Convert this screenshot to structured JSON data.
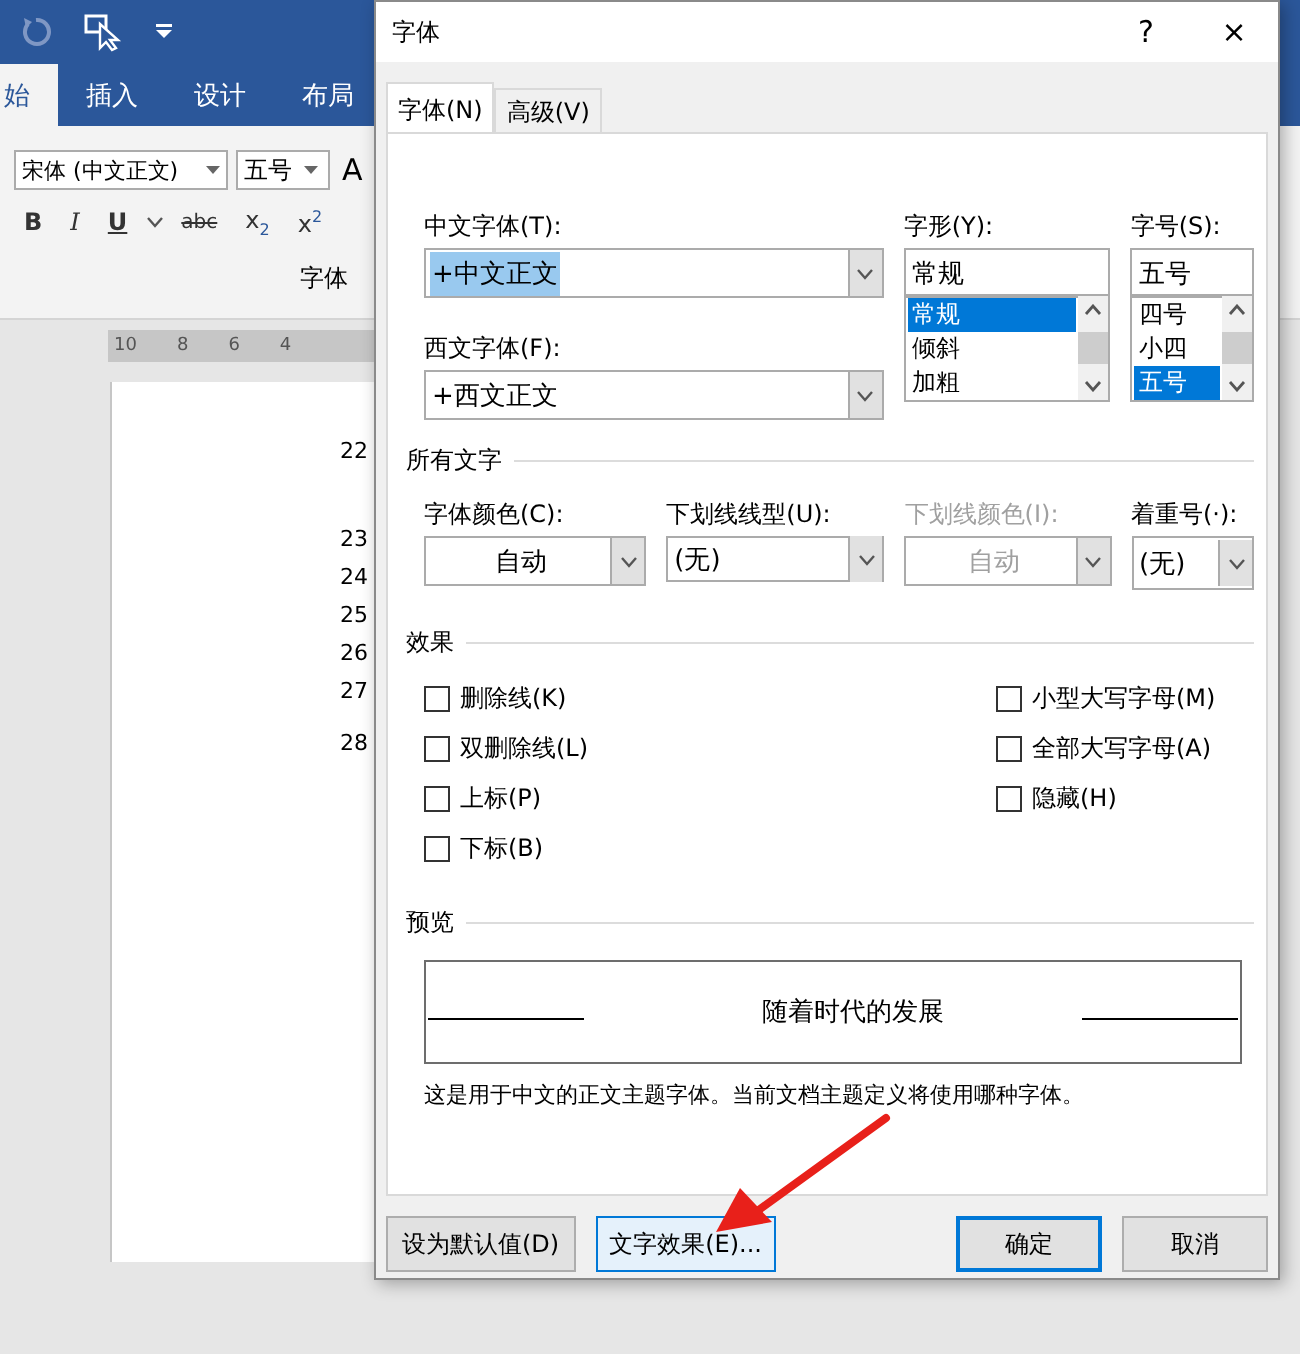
{
  "word": {
    "ribbon_tabs": [
      {
        "label": "始",
        "selected": true
      },
      {
        "label": "插入",
        "selected": false
      },
      {
        "label": "设计",
        "selected": false
      },
      {
        "label": "布局",
        "selected": false
      }
    ],
    "font_name": "宋体 (中文正文)",
    "font_size": "五号",
    "grow_font": "A",
    "format_buttons": [
      {
        "label": "B",
        "kind": "bold"
      },
      {
        "label": "I",
        "kind": "italic"
      },
      {
        "label": "U",
        "kind": "underline"
      },
      {
        "label": "abc",
        "kind": "strike"
      },
      {
        "label": "x$_{2}$",
        "kind": "plain"
      },
      {
        "label": "x$^{2}$",
        "kind": "plain"
      }
    ],
    "group_label": "字体",
    "ruler": [
      "10",
      "8",
      "6",
      "4"
    ],
    "line_numbers": [
      "22",
      "23",
      "24",
      "25",
      "26",
      "27",
      "28"
    ]
  },
  "dialog": {
    "title": "字体",
    "help": "?",
    "close": "×",
    "tabs": [
      {
        "label": "字体(N)",
        "selected": true
      },
      {
        "label": "高级(V)",
        "selected": false
      }
    ],
    "chinese_font": {
      "label": "中文字体(T):",
      "value": "+中文正文",
      "text_selected": true
    },
    "western_font": {
      "label": "西文字体(F):",
      "value": "+西文正文",
      "text_selected": false
    },
    "style": {
      "label": "字形(Y):",
      "value": "常规",
      "options": [
        {
          "label": "常规",
          "selected": true
        },
        {
          "label": "倾斜",
          "selected": false
        },
        {
          "label": "加粗",
          "selected": false
        }
      ]
    },
    "size": {
      "label": "字号(S):",
      "value": "五号",
      "options": [
        {
          "label": "四号",
          "selected": false
        },
        {
          "label": "小四",
          "selected": false
        },
        {
          "label": "五号",
          "selected": true
        }
      ]
    },
    "all_text": {
      "heading": "所有文字",
      "fields": [
        {
          "label": "字体颜色(C):",
          "value": "自动",
          "kind": "color",
          "disabled": false
        },
        {
          "label": "下划线线型(U):",
          "value": "(无)",
          "kind": "list",
          "disabled": false
        },
        {
          "label": "下划线颜色(I):",
          "value": "自动",
          "kind": "color",
          "disabled": true
        },
        {
          "label": "着重号(·):",
          "value": "(无)",
          "kind": "list",
          "disabled": false
        }
      ]
    },
    "effects": {
      "heading": "效果",
      "left": [
        {
          "label": "删除线(K)",
          "checked": false
        },
        {
          "label": "双删除线(L)",
          "checked": false
        },
        {
          "label": "上标(P)",
          "checked": false
        },
        {
          "label": "下标(B)",
          "checked": false
        }
      ],
      "right": [
        {
          "label": "小型大写字母(M)",
          "checked": false
        },
        {
          "label": "全部大写字母(A)",
          "checked": false
        },
        {
          "label": "隐藏(H)",
          "checked": false
        }
      ]
    },
    "preview": {
      "heading": "预览",
      "sample": "随着时代的发展",
      "note": "这是用于中文的正文主题字体。当前文档主题定义将使用哪种字体。"
    },
    "buttons": [
      {
        "label": "设为默认值(D)",
        "kind": "normal"
      },
      {
        "label": "文字效果(E)...",
        "kind": "hover"
      },
      {
        "label": "确定",
        "kind": "default"
      },
      {
        "label": "取消",
        "kind": "normal"
      }
    ]
  }
}
